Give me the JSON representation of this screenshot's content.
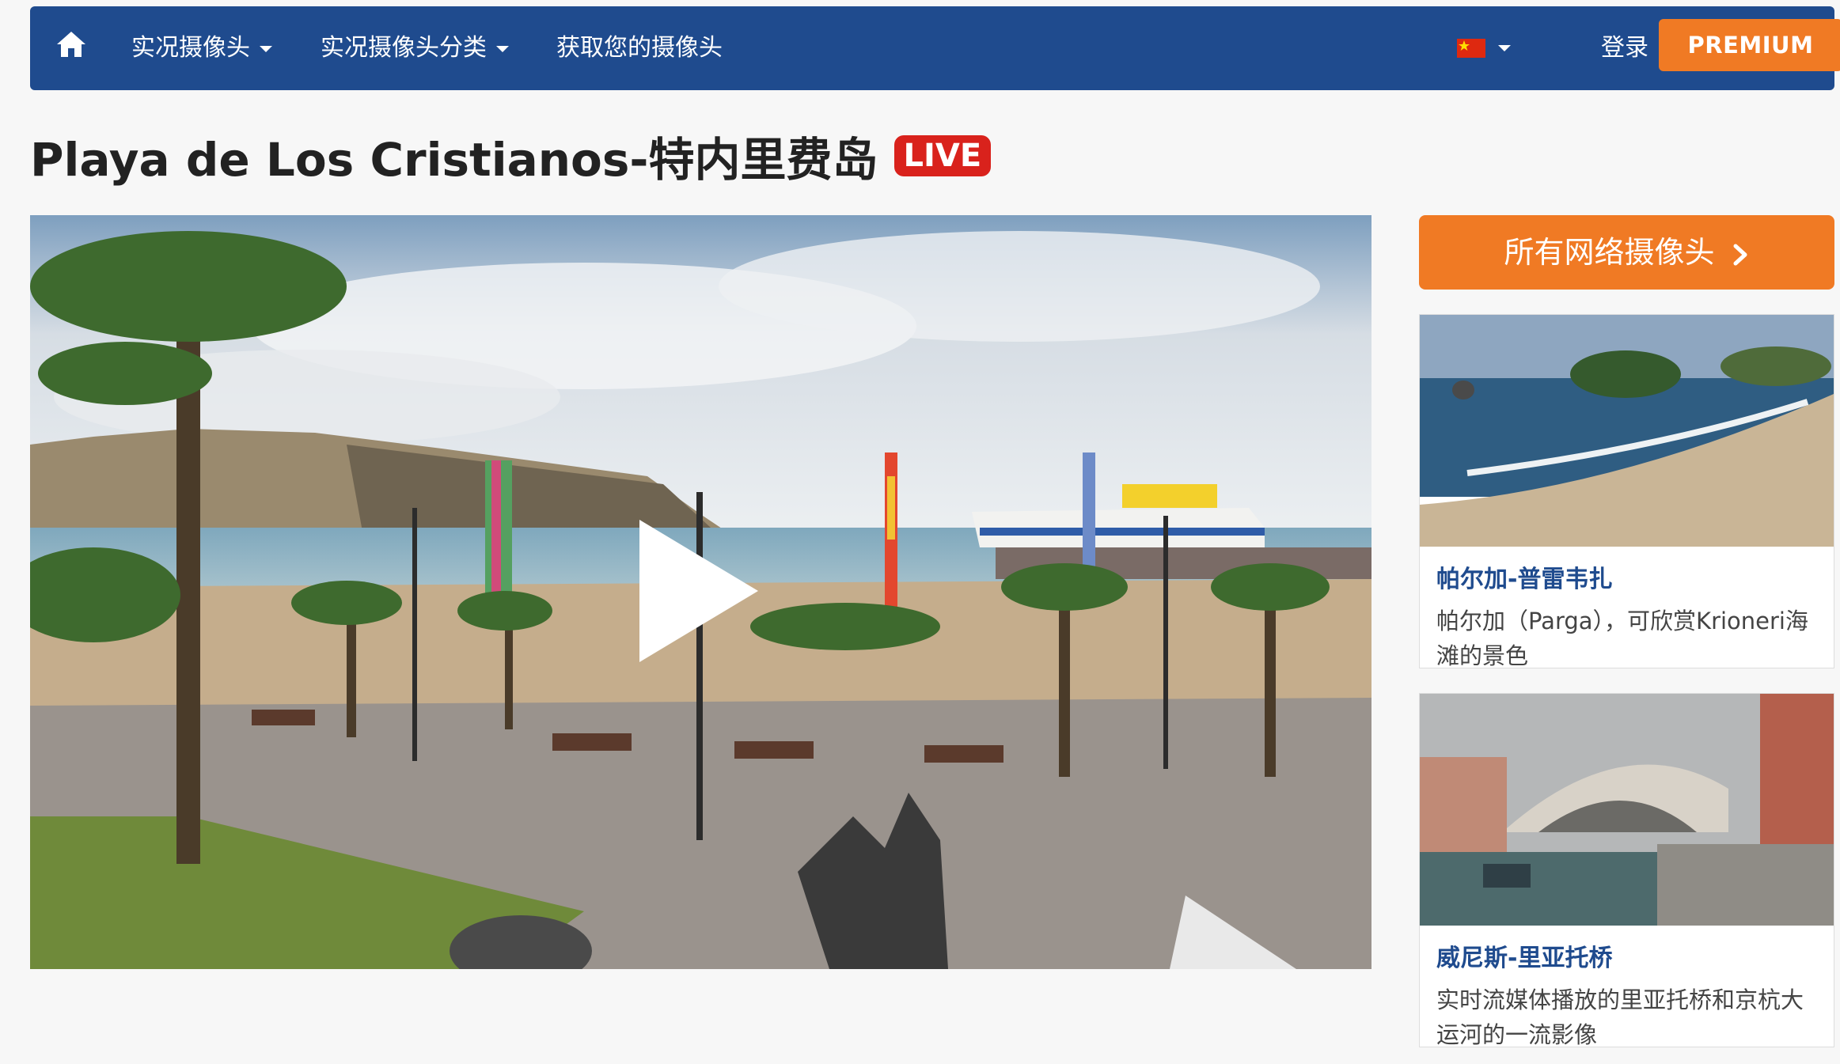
{
  "nav": {
    "live_cams": "实况摄像头",
    "categories": "实况摄像头分类",
    "get_your_cam": "获取您的摄像头",
    "login": "登录",
    "premium": "PREMIUM"
  },
  "page": {
    "title": "Playa de Los Cristianos-特内里费岛",
    "live_badge": "LIVE"
  },
  "sidebar": {
    "all_webcams": "所有网络摄像头",
    "cards": [
      {
        "title": "帕尔加-普雷韦扎",
        "description": "帕尔加（Parga），可欣赏Krioneri海滩的景色"
      },
      {
        "title": "威尼斯-里亚托桥",
        "description": "实时流媒体播放的里亚托桥和京杭大运河的一流影像"
      }
    ]
  },
  "colors": {
    "nav_bg": "#1f4b8e",
    "accent_orange": "#f07a24",
    "live_red": "#d9221c"
  },
  "icons": {
    "home": "home-icon",
    "play": "play-icon",
    "chevron": "chevron-right-icon",
    "flag": "china-flag-icon"
  }
}
